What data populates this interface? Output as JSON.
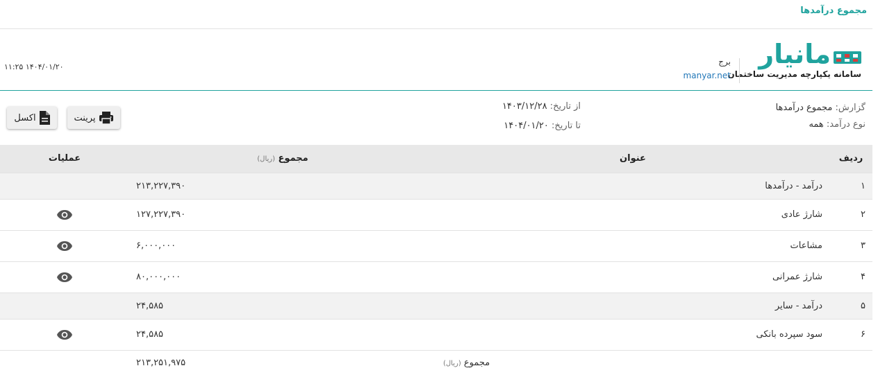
{
  "page": {
    "title": "مجموع درآمدها"
  },
  "brand": {
    "logo_text": "مانیار",
    "tagline": "سامانه یکپارچه مدیریت ساختمان",
    "building": "برج",
    "url": "manyar.net",
    "accent_color": "#20a39e"
  },
  "datetime": "۱۴۰۴/۰۱/۲۰ ۱۱:۲۵",
  "filters": {
    "report_label": "گزارش:",
    "report_value": "مجموع درآمدها",
    "type_label": "نوع درآمد:",
    "type_value": "همه",
    "from_label": "از تاریخ:",
    "from_value": "۱۴۰۳/۱۲/۲۸",
    "to_label": "تا تاریخ:",
    "to_value": "۱۴۰۴/۰۱/۲۰"
  },
  "buttons": {
    "print_label": "پرینت",
    "print_icon": "printer-icon",
    "excel_label": "اکسل",
    "excel_icon": "file-icon"
  },
  "table": {
    "columns": {
      "index": "ردیف",
      "title": "عنوان",
      "sum": "مجموع",
      "sum_unit": "(ریال)",
      "ops": "عملیات"
    },
    "rows": [
      {
        "index": "۱",
        "title": "درآمد - درآمدها",
        "sum": "۲۱۳,۲۲۷,۳۹۰",
        "kind": "group",
        "view": false
      },
      {
        "index": "۲",
        "title": "شارژ عادی",
        "sum": "۱۲۷,۲۲۷,۳۹۰",
        "kind": "item",
        "view": true
      },
      {
        "index": "۳",
        "title": "مشاعات",
        "sum": "۶,۰۰۰,۰۰۰",
        "kind": "item",
        "view": true
      },
      {
        "index": "۴",
        "title": "شارژ عمرانی",
        "sum": "۸۰,۰۰۰,۰۰۰",
        "kind": "item",
        "view": true
      },
      {
        "index": "۵",
        "title": "درآمد - سایر",
        "sum": "۲۴,۵۸۵",
        "kind": "group",
        "view": false
      },
      {
        "index": "۶",
        "title": "سود سپرده بانکی",
        "sum": "۲۴,۵۸۵",
        "kind": "item",
        "view": true
      }
    ],
    "footer": {
      "label": "مجموع",
      "unit": "(ریال)",
      "total": "۲۱۳,۲۵۱,۹۷۵"
    }
  }
}
